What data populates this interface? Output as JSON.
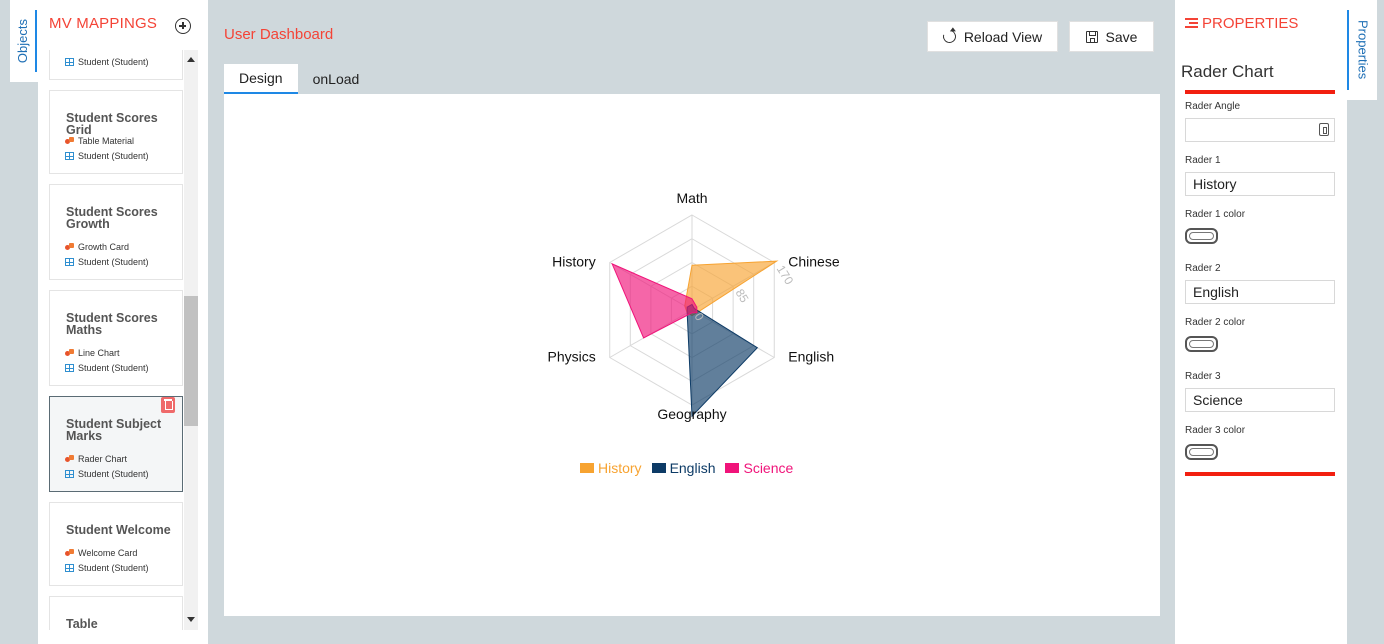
{
  "left_rail": {
    "objects_tab": "Objects"
  },
  "mappings": {
    "title": "MV MAPPINGS",
    "top_partial_source": "Student (Student)",
    "cards": [
      {
        "title": "Student Scores Grid",
        "component": "Table Material",
        "source": "Student (Student)"
      },
      {
        "title": "Student Scores Growth",
        "component": "Growth Card",
        "source": "Student (Student)"
      },
      {
        "title": "Student Scores Maths",
        "component": "Line Chart",
        "source": "Student (Student)"
      },
      {
        "title": "Student Subject Marks",
        "component": "Rader Chart",
        "source": "Student (Student)"
      },
      {
        "title": "Student Welcome",
        "component": "Welcome Card",
        "source": "Student (Student)"
      },
      {
        "title": "Table",
        "component": "",
        "source": ""
      }
    ]
  },
  "main": {
    "title": "User Dashboard",
    "reload_label": "Reload View",
    "save_label": "Save",
    "tabs": [
      {
        "label": "Design"
      },
      {
        "label": "onLoad"
      }
    ]
  },
  "properties": {
    "title": "PROPERTIES",
    "heading": "Rader Chart",
    "angle_label": "Rader Angle",
    "angle_value": "",
    "rader1_label": "Rader 1",
    "rader1_value": "History",
    "rader1_color_label": "Rader 1 color",
    "rader2_label": "Rader 2",
    "rader2_value": "English",
    "rader2_color_label": "Rader 2 color",
    "rader3_label": "Rader 3",
    "rader3_value": "Science",
    "rader3_color_label": "Rader 3 color"
  },
  "right_rail": {
    "properties_tab": "Properties"
  },
  "colors": {
    "accent_red": "#f44336",
    "tab_blue": "#1e88e5",
    "history": "#f7a331",
    "english": "#0d3b66",
    "science": "#f0147a"
  },
  "chart_data": {
    "type": "radar",
    "axes": [
      "Math",
      "Chinese",
      "English",
      "Geography",
      "Physics",
      "History"
    ],
    "radial_ticks": [
      "0",
      "85",
      "170"
    ],
    "max": 170,
    "series": [
      {
        "name": "History",
        "color": "#f7a331",
        "values": [
          80,
          175,
          10,
          10,
          10,
          15
        ]
      },
      {
        "name": "English",
        "color": "#0d3b66",
        "values": [
          10,
          5,
          135,
          190,
          10,
          10
        ]
      },
      {
        "name": "Science",
        "color": "#f0147a",
        "values": [
          20,
          10,
          10,
          5,
          100,
          165
        ]
      }
    ]
  }
}
